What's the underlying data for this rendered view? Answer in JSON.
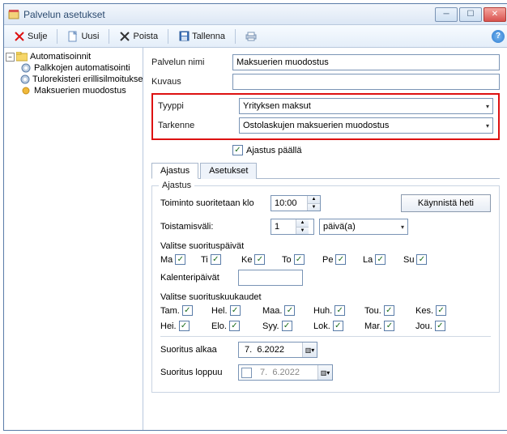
{
  "window": {
    "title": "Palvelun asetukset"
  },
  "toolbar": {
    "close": "Sulje",
    "new": "Uusi",
    "delete": "Poista",
    "save": "Tallenna"
  },
  "tree": {
    "root": "Automatisoinnit",
    "items": [
      "Palkkojen automatisointi",
      "Tulorekisteri erillisilmoitukse",
      "Maksuerien muodostus"
    ]
  },
  "form": {
    "name_label": "Palvelun nimi",
    "name_value": "Maksuerien muodostus",
    "desc_label": "Kuvaus",
    "desc_value": "",
    "type_label": "Tyyppi",
    "type_value": "Yrityksen maksut",
    "spec_label": "Tarkenne",
    "spec_value": "Ostolaskujen maksuerien muodostus",
    "scheduling_on": "Ajastus päällä"
  },
  "tabs": {
    "scheduling": "Ajastus",
    "settings": "Asetukset"
  },
  "sched": {
    "group": "Ajastus",
    "run_at_label": "Toiminto suoritetaan klo",
    "run_at_value": "10:00",
    "run_now": "Käynnistä heti",
    "interval_label": "Toistamisväli:",
    "interval_value": "1",
    "interval_unit": "päivä(a)",
    "days_label": "Valitse suorituspäivät",
    "days": [
      "Ma",
      "Ti",
      "Ke",
      "To",
      "Pe",
      "La",
      "Su"
    ],
    "calendar_days_label": "Kalenteripäivät",
    "calendar_days_value": "",
    "months_label": "Valitse suorituskuukaudet",
    "months_row1": [
      "Tam.",
      "Hel.",
      "Maa.",
      "Huh.",
      "Tou.",
      "Kes."
    ],
    "months_row2": [
      "Hei.",
      "Elo.",
      "Syy.",
      "Lok.",
      "Mar.",
      "Jou."
    ],
    "start_label": "Suoritus alkaa",
    "start_value": " 7.  6.2022",
    "end_label": "Suoritus loppuu",
    "end_value": " 7.  6.2022"
  }
}
